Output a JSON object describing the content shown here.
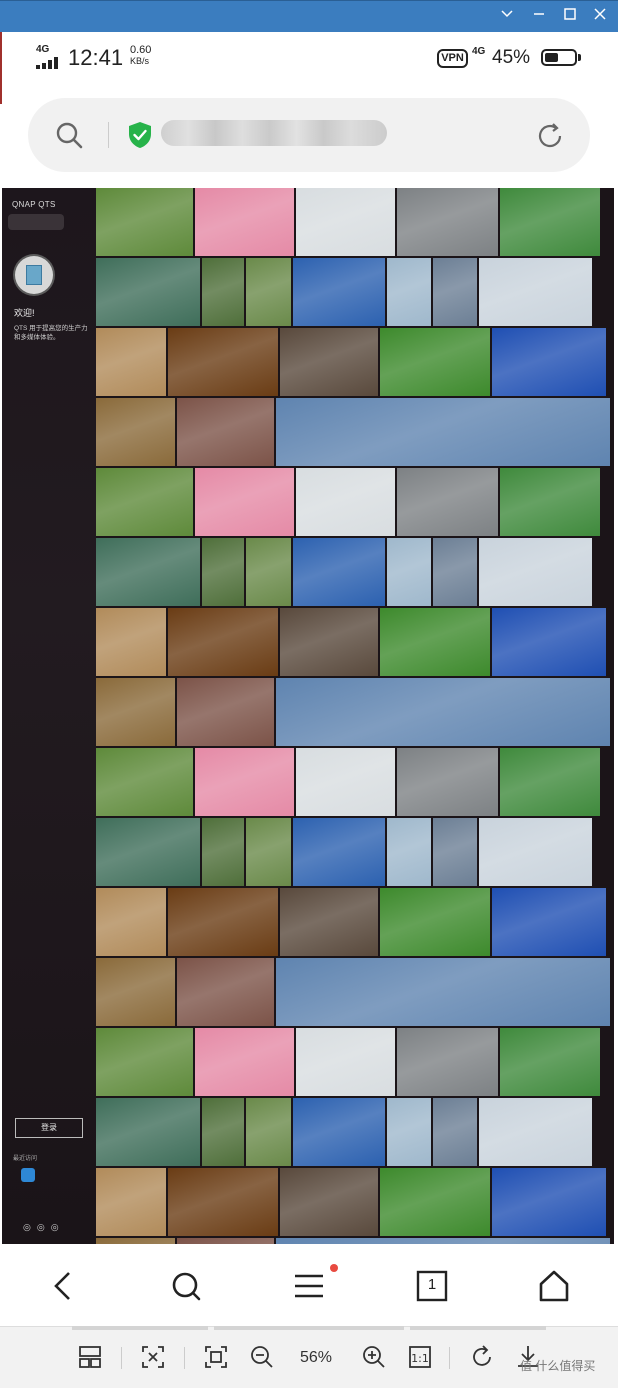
{
  "window": {
    "controls": [
      "chevron-down",
      "minimize",
      "maximize",
      "close"
    ]
  },
  "status": {
    "network": "4G",
    "time": "12:41",
    "speed_value": "0.60",
    "speed_unit": "KB/s",
    "vpn": "VPN",
    "network2": "4G",
    "battery_text": "45%",
    "battery_level": 0.45
  },
  "address": {
    "url": "",
    "secure": true
  },
  "qts": {
    "brand": "QNAP QTS",
    "welcome": "欢迎!",
    "description": "QTS 用于提高您的生产力和多媒体体验。",
    "login": "登录",
    "recent": "最近访问"
  },
  "photo_rows": [
    [
      {
        "w": 99,
        "c": "#5e8a3a"
      },
      {
        "w": 101,
        "c": "#e58aa6"
      },
      {
        "w": 101,
        "c": "#d8dde0"
      },
      {
        "w": 103,
        "c": "#7d8184"
      },
      {
        "w": 102,
        "c": "#3f8a3c"
      }
    ],
    [
      {
        "w": 106,
        "c": "#3f6e5a"
      },
      {
        "w": 44,
        "c": "#4f6f3a"
      },
      {
        "w": 47,
        "c": "#6a8a4a"
      },
      {
        "w": 94,
        "c": "#2c61b0"
      },
      {
        "w": 46,
        "c": "#9fb8cc"
      },
      {
        "w": 46,
        "c": "#6c7f95"
      },
      {
        "w": 115,
        "c": "#c9d3dc"
      }
    ],
    [
      {
        "w": 72,
        "c": "#b18b5a"
      },
      {
        "w": 112,
        "c": "#6a3c14"
      },
      {
        "w": 100,
        "c": "#59493c"
      },
      {
        "w": 112,
        "c": "#3d8a2c"
      },
      {
        "w": 116,
        "c": "#1f4fb3"
      }
    ],
    [
      {
        "w": 81,
        "c": "#8a6a3a"
      },
      {
        "w": 99,
        "c": "#7c5348"
      },
      {
        "w": 336,
        "c": "#5f84b0"
      }
    ]
  ],
  "nav": {
    "tab_count": "1",
    "has_notification": true
  },
  "tabsbar": {
    "zoom": "56%",
    "watermark": "值 什么值得买"
  }
}
